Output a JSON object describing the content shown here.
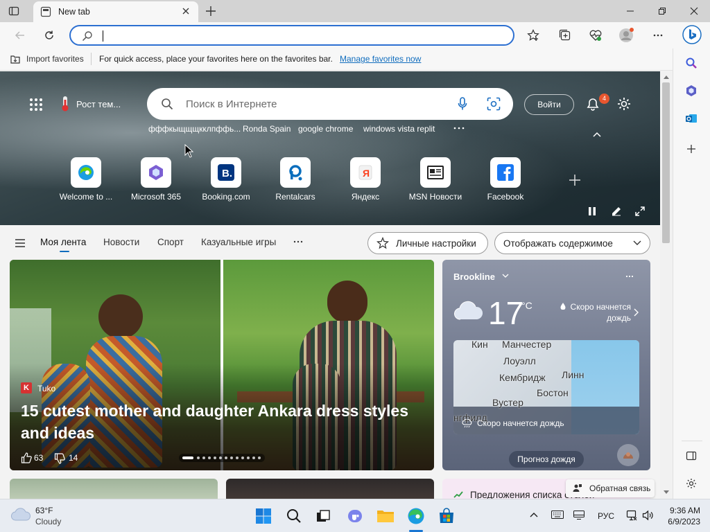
{
  "browser": {
    "tab_title": "New tab",
    "address_value": "",
    "favorites_bar": {
      "import_label": "Import favorites",
      "hint": "For quick access, place your favorites here on the favorites bar.",
      "manage_link": "Manage favorites now"
    },
    "colors": {
      "accent": "#2c6fd1",
      "notification": "#e8562f"
    }
  },
  "newtab": {
    "weather_chip": "Рост тем...",
    "search_placeholder": "Поиск в Интернете",
    "signin_label": "Войти",
    "notification_count": "4",
    "trending": [
      "фффкыщщщкклпффь...",
      "Ronda Spain",
      "google chrome",
      "windows vista replit"
    ],
    "quick_links": [
      {
        "label": "Welcome to ...",
        "icon": "edge-icon"
      },
      {
        "label": "Microsoft 365",
        "icon": "m365-icon"
      },
      {
        "label": "Booking.com",
        "icon": "booking-icon"
      },
      {
        "label": "Rentalcars",
        "icon": "rentalcars-icon"
      },
      {
        "label": "Яндекс",
        "icon": "yandex-icon"
      },
      {
        "label": "MSN Новости",
        "icon": "msn-news-icon"
      },
      {
        "label": "Facebook",
        "icon": "facebook-icon"
      }
    ],
    "feed_tabs": [
      "Моя лента",
      "Новости",
      "Спорт",
      "Казуальные игры"
    ],
    "personalize_label": "Личные настройки",
    "display_content_label": "Отображать содержимое",
    "story": {
      "source": "Tuko",
      "title": "15 cutest mother and daughter Ankara dress styles and ideas",
      "likes": "63",
      "dislikes": "14"
    },
    "weather": {
      "location": "Brookline",
      "temperature": "17",
      "unit": "°C",
      "forecast": "Скоро начнется дождь",
      "map_labels": [
        "Кин",
        "Манчестер",
        "Лоуэлл",
        "Кембридж",
        "Линн",
        "Вустер",
        "Бостон",
        "нгфилд"
      ],
      "map_alert": "Скоро начнется дождь",
      "rain_forecast_button": "Прогноз дождя"
    },
    "next_card_title": "Предложения списка отелей",
    "feedback_label": "Обратная связь"
  },
  "taskbar": {
    "weather_temp": "63°F",
    "weather_desc": "Cloudy",
    "language": "РУС",
    "time": "9:36 AM",
    "date": "6/9/2023"
  }
}
